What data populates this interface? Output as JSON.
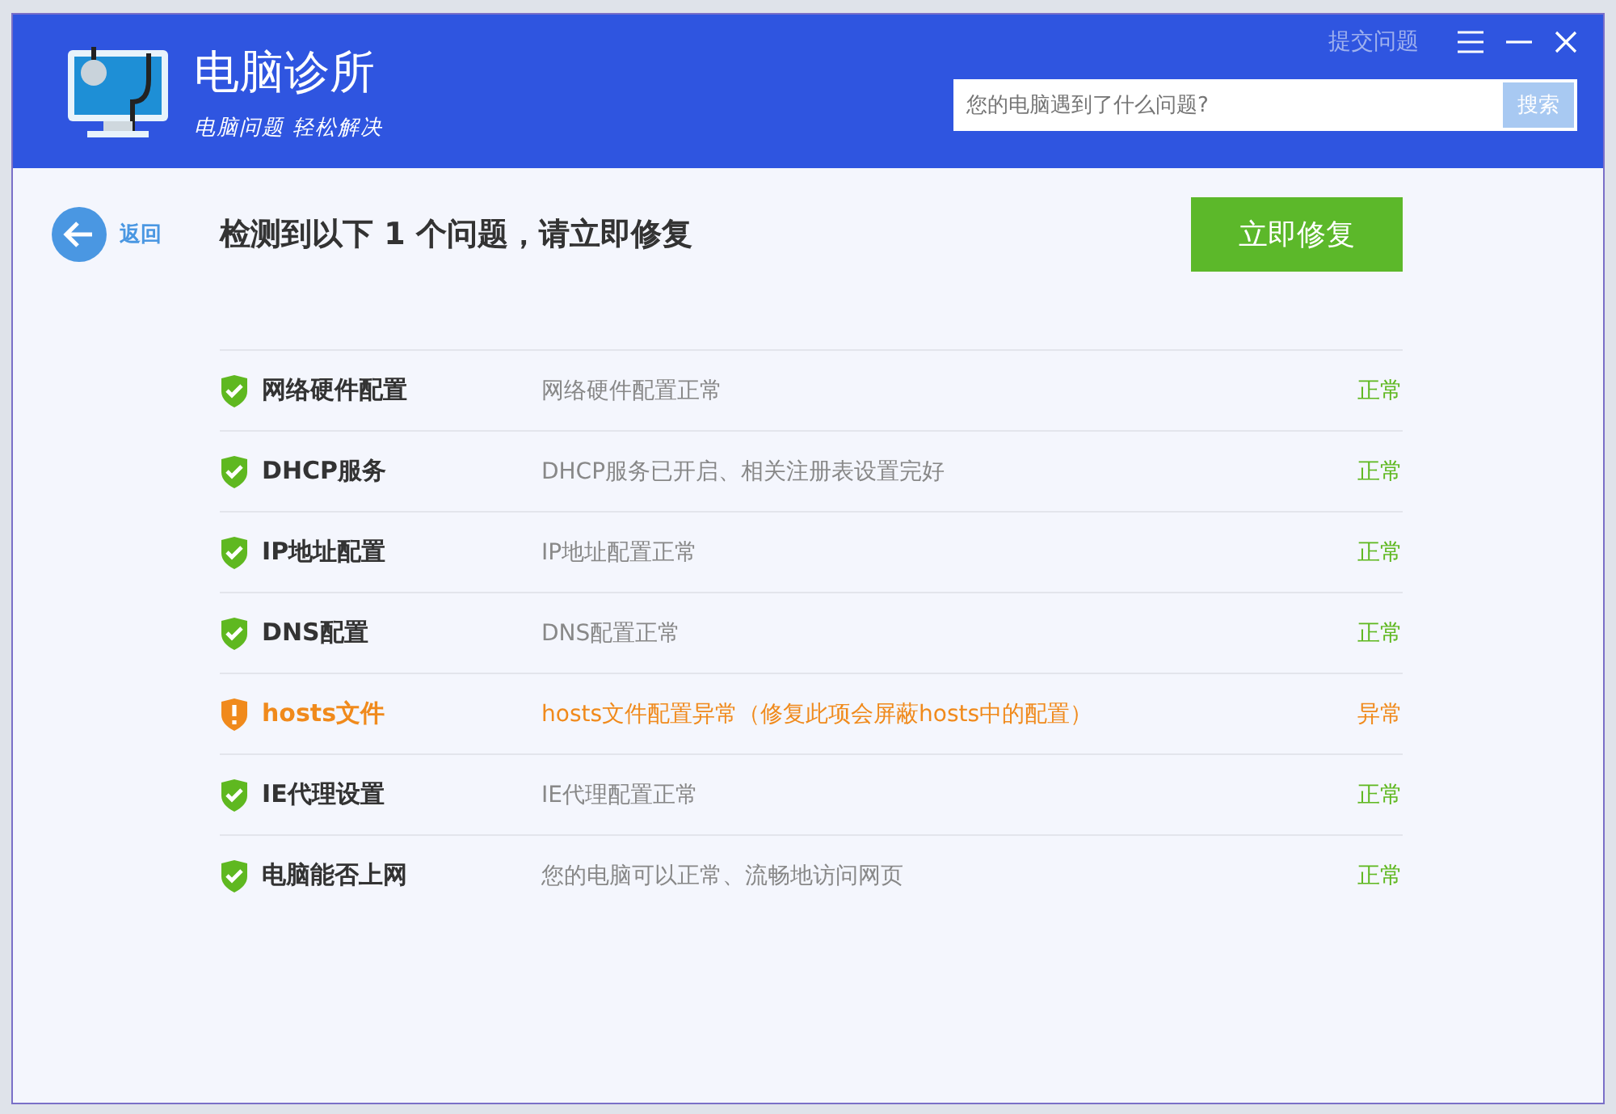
{
  "header": {
    "app_name": "电脑诊所",
    "slogan": "电脑问题 轻松解决",
    "feedback_link": "提交问题",
    "search": {
      "placeholder": "您的电脑遇到了什么问题?",
      "button": "搜索"
    }
  },
  "toolbar": {
    "back": "返回",
    "summary": "检测到以下 1 个问题，请立即修复",
    "fix_button": "立即修复"
  },
  "checks": [
    {
      "name": "网络硬件配置",
      "detail": "网络硬件配置正常",
      "result": "正常",
      "kind": "ok"
    },
    {
      "name": "DHCP服务",
      "detail": "DHCP服务已开启、相关注册表设置完好",
      "result": "正常",
      "kind": "ok"
    },
    {
      "name": "IP地址配置",
      "detail": "IP地址配置正常",
      "result": "正常",
      "kind": "ok"
    },
    {
      "name": "DNS配置",
      "detail": "DNS配置正常",
      "result": "正常",
      "kind": "ok"
    },
    {
      "name": "hosts文件",
      "detail": "hosts文件配置异常（修复此项会屏蔽hosts中的配置）",
      "result": "异常",
      "kind": "warning"
    },
    {
      "name": "IE代理设置",
      "detail": "IE代理配置正常",
      "result": "正常",
      "kind": "ok"
    },
    {
      "name": "电脑能否上网",
      "detail": "您的电脑可以正常、流畅地访问网页",
      "result": "正常",
      "kind": "ok"
    }
  ]
}
